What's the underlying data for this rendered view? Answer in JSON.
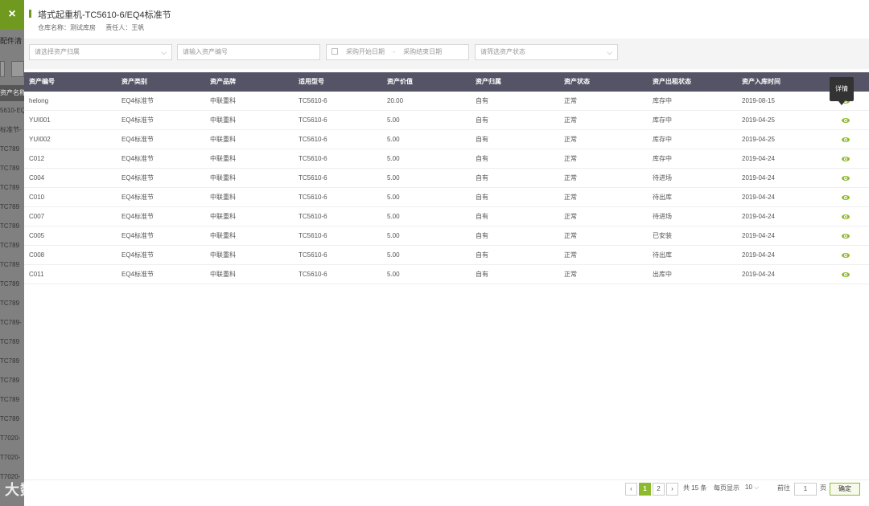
{
  "background": {
    "close_label": "×",
    "title": "配件清",
    "list_header": "资产名称",
    "list_items": [
      "5610-EQ",
      "标准节-",
      "TC789",
      "TC789",
      "TC789",
      "TC789",
      "TC789",
      "TC789",
      "TC789",
      "TC789",
      "TC789",
      "TC789-",
      "TC789",
      "TC789",
      "TC789",
      "TC789",
      "TC789",
      "T7020-",
      "T7020-",
      "T7020-"
    ],
    "watermark": "大数跨境"
  },
  "dialog": {
    "title": "塔式起重机-TC5610-6/EQ4标准节",
    "warehouse": "仓库名称：测试库房",
    "owner": "责任人：王帆"
  },
  "filters": {
    "attribution_placeholder": "请选择资产归属",
    "asset_no_placeholder": "请输入资产编号",
    "date_start_placeholder": "采购开始日期",
    "date_sep": "-",
    "date_end_placeholder": "采购结束日期",
    "status_placeholder": "请筛选资产状态"
  },
  "table": {
    "headers": [
      "资产编号",
      "资产类别",
      "资产品牌",
      "适用型号",
      "资产价值",
      "资产归属",
      "资产状态",
      "资产出租状态",
      "资产入库时间"
    ],
    "rows": [
      [
        "helong",
        "EQ4标准节",
        "中联重科",
        "TC5610-6",
        "20.00",
        "自有",
        "正常",
        "库存中",
        "2019-08-15"
      ],
      [
        "YUI001",
        "EQ4标准节",
        "中联重科",
        "TC5610-6",
        "5.00",
        "自有",
        "正常",
        "库存中",
        "2019-04-25"
      ],
      [
        "YUI002",
        "EQ4标准节",
        "中联重科",
        "TC5610-6",
        "5.00",
        "自有",
        "正常",
        "库存中",
        "2019-04-25"
      ],
      [
        "C012",
        "EQ4标准节",
        "中联重科",
        "TC5610-6",
        "5.00",
        "自有",
        "正常",
        "库存中",
        "2019-04-24"
      ],
      [
        "C004",
        "EQ4标准节",
        "中联重科",
        "TC5610-6",
        "5.00",
        "自有",
        "正常",
        "待进场",
        "2019-04-24"
      ],
      [
        "C010",
        "EQ4标准节",
        "中联重科",
        "TC5610-6",
        "5.00",
        "自有",
        "正常",
        "待出库",
        "2019-04-24"
      ],
      [
        "C007",
        "EQ4标准节",
        "中联重科",
        "TC5610-6",
        "5.00",
        "自有",
        "正常",
        "待进场",
        "2019-04-24"
      ],
      [
        "C005",
        "EQ4标准节",
        "中联重科",
        "TC5610-6",
        "5.00",
        "自有",
        "正常",
        "已安装",
        "2019-04-24"
      ],
      [
        "C008",
        "EQ4标准节",
        "中联重科",
        "TC5610-6",
        "5.00",
        "自有",
        "正常",
        "待出库",
        "2019-04-24"
      ],
      [
        "C011",
        "EQ4标准节",
        "中联重科",
        "TC5610-6",
        "5.00",
        "自有",
        "正常",
        "出库中",
        "2019-04-24"
      ]
    ],
    "action_icon": "eye-icon",
    "tooltip": "详情"
  },
  "pagination": {
    "prev": "‹",
    "pages": [
      "1",
      "2"
    ],
    "current_page": "1",
    "next": "›",
    "total": "共 15 条",
    "per_page_label": "每页显示",
    "per_page_value": "10",
    "goto_label": "前往",
    "goto_value": "1",
    "page_unit": "页",
    "confirm": "确定"
  },
  "colors": {
    "accent": "#8dbb2c",
    "table_header": "#545466"
  }
}
